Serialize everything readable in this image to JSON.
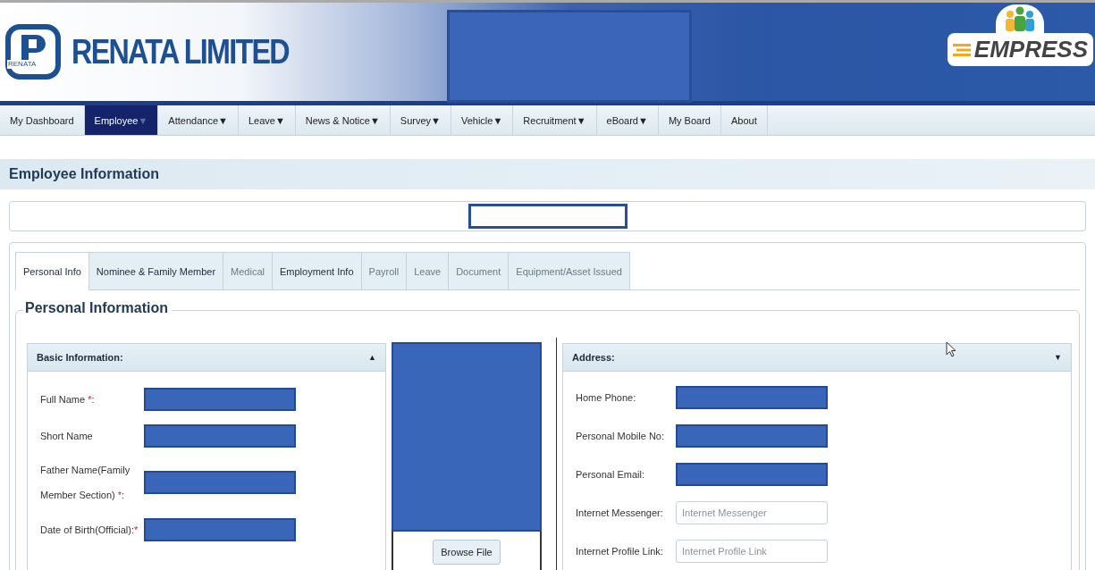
{
  "header": {
    "company": "RENATA LIMITED",
    "logo_small": "RENATA",
    "banner_redacted": true,
    "app_name": "EMPRESS"
  },
  "nav": [
    {
      "label": "My Dashboard",
      "selected": false
    },
    {
      "label": "Employee",
      "caret": "▼",
      "selected": true
    },
    {
      "label": "Attendance",
      "caret": "▼",
      "selected": false
    },
    {
      "label": "Leave",
      "caret": "▼",
      "selected": false
    },
    {
      "label": "News & Notice",
      "caret": "▼",
      "selected": false
    },
    {
      "label": "Survey",
      "caret": "▼",
      "selected": false
    },
    {
      "label": "Vehicle",
      "caret": "▼",
      "selected": false
    },
    {
      "label": "Recruitment",
      "caret": "▼",
      "selected": false
    },
    {
      "label": "eBoard",
      "caret": "▼",
      "selected": false
    },
    {
      "label": "My Board",
      "selected": false
    },
    {
      "label": "About",
      "selected": false
    }
  ],
  "page_title": "Employee Information",
  "employee_select": {
    "redacted": true
  },
  "tabs": [
    {
      "label": "Personal Info",
      "selected": true,
      "disabled": false
    },
    {
      "label": "Nominee & Family Member",
      "selected": false,
      "disabled": false
    },
    {
      "label": "Medical",
      "selected": false,
      "disabled": true
    },
    {
      "label": "Employment Info",
      "selected": false,
      "disabled": false
    },
    {
      "label": "Payroll",
      "selected": false,
      "disabled": true
    },
    {
      "label": "Leave",
      "selected": false,
      "disabled": true
    },
    {
      "label": "Document",
      "selected": false,
      "disabled": true
    },
    {
      "label": "Equipment/Asset Issued",
      "selected": false,
      "disabled": true
    }
  ],
  "section_title": "Personal Information",
  "basic_panel": {
    "title": "Basic Information:",
    "toggle": "▲",
    "fields": [
      {
        "label": "Full Name ",
        "mark": "*",
        "after": ":",
        "redacted": true
      },
      {
        "label": "Short Name",
        "redacted": true
      },
      {
        "label": "Father Name(Family Member Section) ",
        "mark": "*",
        "after": ":",
        "redacted": true
      },
      {
        "label": "Date of Birth(Official):",
        "mark": "*",
        "redacted": true
      }
    ]
  },
  "photo": {
    "redacted": true,
    "button": "Browse File"
  },
  "address_panel": {
    "title": "Address:",
    "toggle": "▼",
    "fields": [
      {
        "label": "Home Phone:",
        "redacted": true
      },
      {
        "label": "Personal Mobile No:",
        "redacted": true
      },
      {
        "label": "Personal Email:",
        "redacted": true
      },
      {
        "label": "Internet Messenger:",
        "redacted": false,
        "placeholder": "Internet Messenger"
      },
      {
        "label": "Internet Profile Link:",
        "redacted": false,
        "placeholder": "Internet Profile Link"
      }
    ]
  }
}
